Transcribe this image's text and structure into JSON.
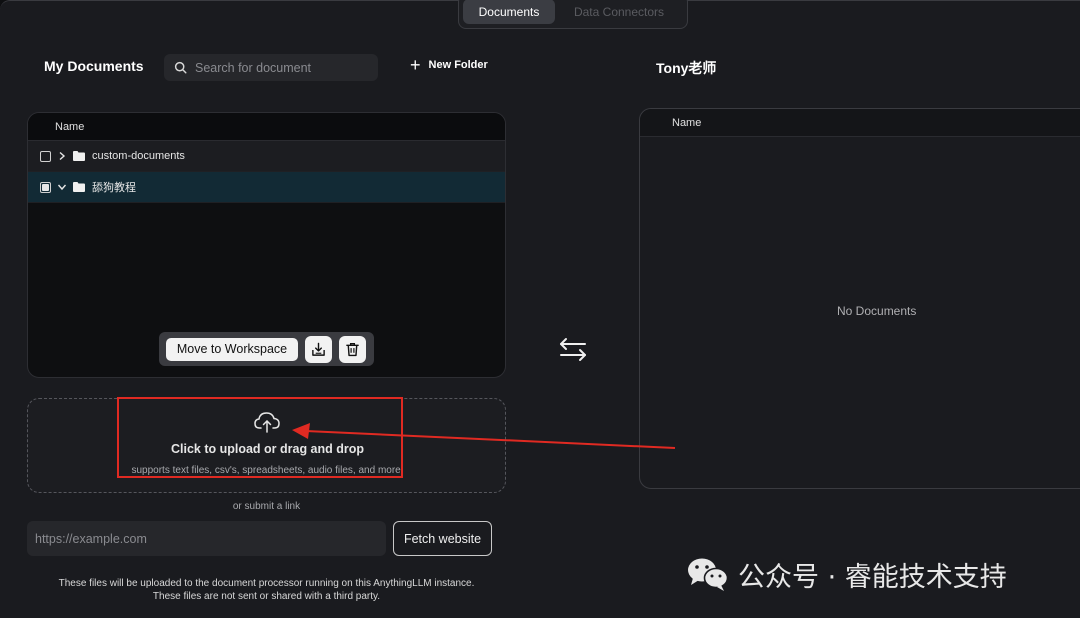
{
  "top_tabs": [
    {
      "label": "Documents",
      "active": true
    },
    {
      "label": "Data Connectors",
      "active": false
    }
  ],
  "my_documents": {
    "title": "My Documents",
    "search_placeholder": "Search for document",
    "new_folder_label": "New Folder",
    "column_name": "Name",
    "rows": [
      {
        "name": "custom-documents",
        "checked": false,
        "expanded": false
      },
      {
        "name": "舔狗教程",
        "checked": true,
        "expanded": true
      }
    ],
    "actions": {
      "move_label": "Move to Workspace",
      "download_icon": "download-icon",
      "delete_icon": "trash-icon"
    }
  },
  "workspace": {
    "title": "Tony老师",
    "column_name": "Name",
    "empty_text": "No Documents"
  },
  "upload": {
    "title": "Click to upload or drag and drop",
    "subtitle": "supports text files, csv's, spreadsheets, audio files, and more!",
    "or_link": "or submit a link",
    "url_placeholder": "https://example.com",
    "fetch_label": "Fetch website",
    "footnote_line1": "These files will be uploaded to the document processor running on this AnythingLLM instance.",
    "footnote_line2": "These files are not sent or shared with a third party."
  },
  "watermark": {
    "text": "公众号 · 睿能技术支持"
  },
  "colors": {
    "background": "#1a1b1f",
    "selected_row": "#122a35",
    "annotation_red": "#e02a22"
  }
}
